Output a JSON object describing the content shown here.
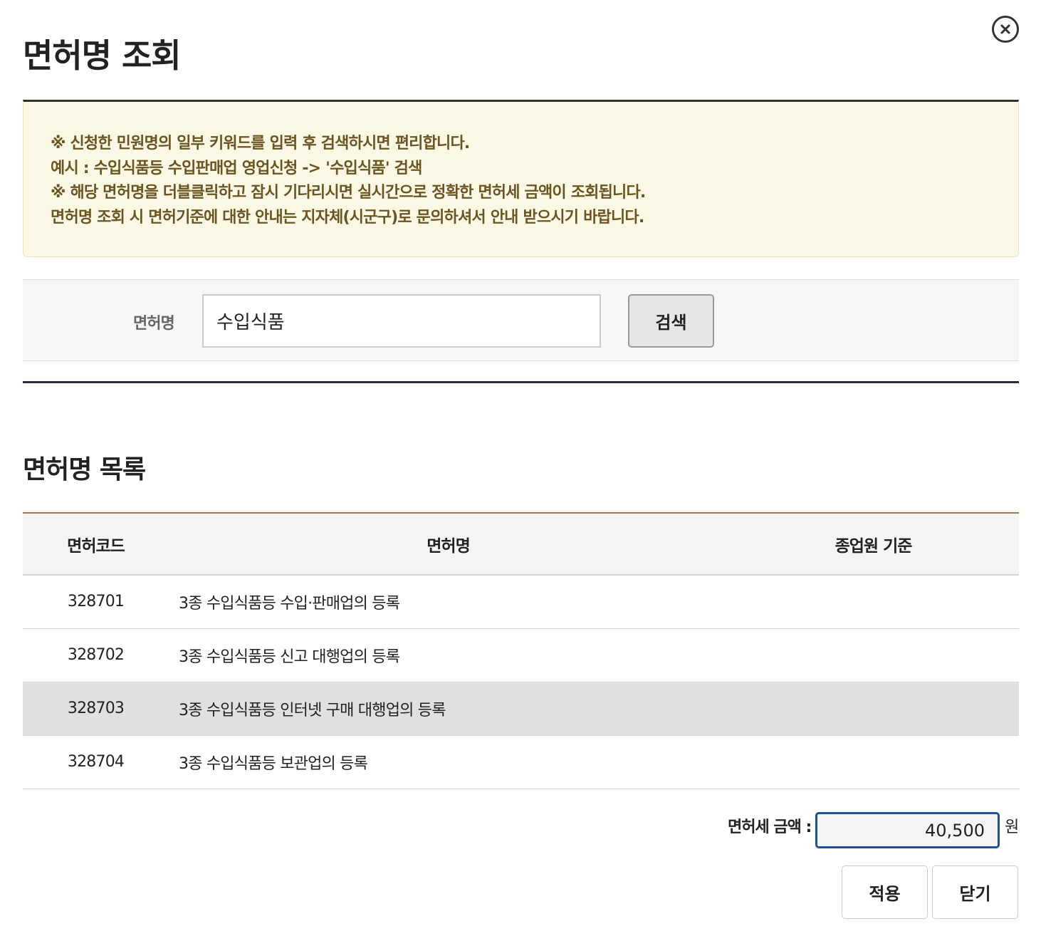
{
  "dialog": {
    "title": "면허명 조회"
  },
  "notice": {
    "lines": [
      "※ 신청한 민원명의 일부 키워드를 입력 후 검색하시면 편리합니다.",
      "예시 : 수입식품등 수입판매업 영업신청 -> '수입식품' 검색",
      "※ 해당 면허명을 더블클릭하고 잠시 기다리시면 실시간으로 정확한 면허세 금액이 조회됩니다.",
      "면허명 조회 시 면허기준에 대한 안내는 지자체(시군구)로 문의하셔서 안내 받으시기 바랍니다."
    ]
  },
  "search": {
    "label": "면허명",
    "value": "수입식품",
    "button": "검색"
  },
  "list": {
    "title": "면허명 목록",
    "columns": [
      "면허코드",
      "면허명",
      "종업원 기준"
    ],
    "rows": [
      {
        "code": "328701",
        "name": "3종 수입식품등 수입·판매업의 등록",
        "staff": ""
      },
      {
        "code": "328702",
        "name": "3종 수입식품등 신고 대행업의 등록",
        "staff": ""
      },
      {
        "code": "328703",
        "name": "3종 수입식품등 인터넷 구매 대행업의 등록",
        "staff": ""
      },
      {
        "code": "328704",
        "name": "3종 수입식품등 보관업의 등록",
        "staff": ""
      }
    ],
    "selected_row": 2
  },
  "tax": {
    "label": "면허세 금액 :",
    "value": "40,500",
    "unit": "원"
  },
  "actions": {
    "apply": "적용",
    "close": "닫기"
  },
  "colors": {
    "notice_bg": "#fcf8e6",
    "notice_text": "#6b5420",
    "table_top_border": "#b86b55",
    "selected_row_bg": "#e0e0e0",
    "focus_border": "#1e4fa3"
  }
}
